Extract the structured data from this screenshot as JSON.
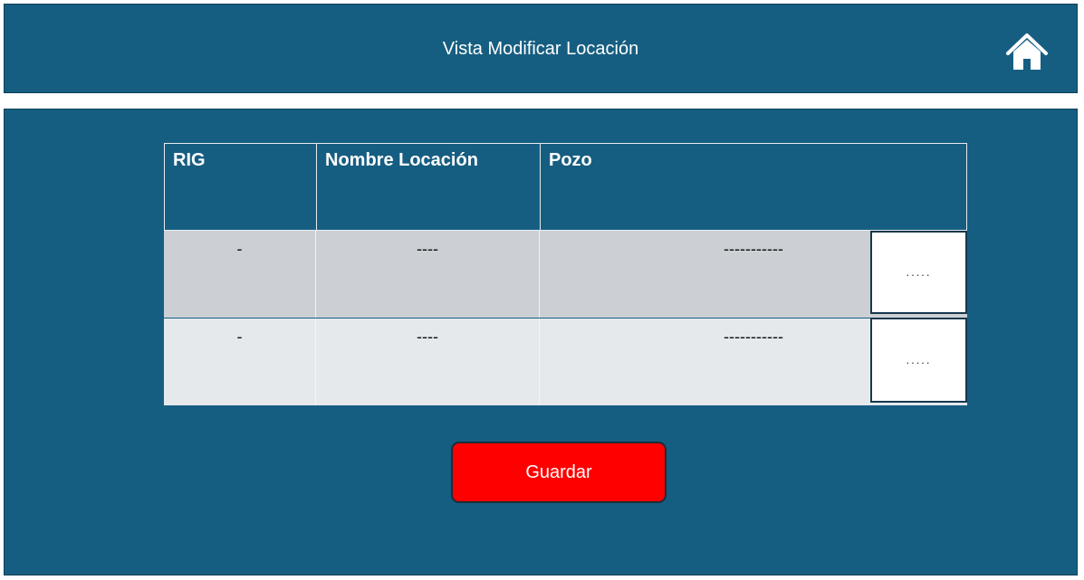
{
  "header": {
    "title": "Vista Modificar Locación",
    "home_icon": "home-icon"
  },
  "table": {
    "columns": [
      "RIG",
      "Nombre Locación",
      "Pozo"
    ],
    "rows": [
      {
        "rig": "-",
        "nombre": "----",
        "pozo": "-----------",
        "action": "....."
      },
      {
        "rig": "-",
        "nombre": "----",
        "pozo": "-----------",
        "action": "....."
      }
    ]
  },
  "save_button": {
    "label": "Guardar"
  },
  "colors": {
    "primary": "#165e81",
    "row_odd": "#ccd0d5",
    "row_even": "#e6e9ec",
    "save": "#ff0000"
  }
}
